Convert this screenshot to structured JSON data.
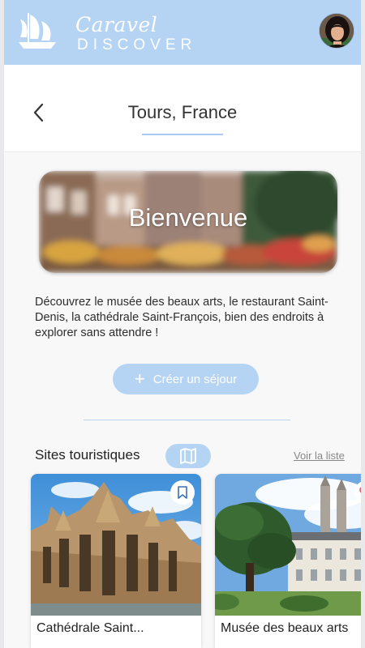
{
  "app": {
    "logo_script": "Caravel",
    "logo_word": "DISCOVER"
  },
  "header": {
    "title": "Tours, France"
  },
  "hero": {
    "title": "Bienvenue"
  },
  "intro": {
    "text": "Découvrez le musée des beaux arts, le restaurant Saint-Denis, la cathédrale Saint-François, bien des endroits à explorer sans attendre !"
  },
  "actions": {
    "create_stay_label": "Créer un séjour",
    "create_stay_icon": "plus-icon"
  },
  "sites": {
    "section_title": "Sites touristiques",
    "view_list_label": "Voir la liste",
    "map_icon": "map-icon",
    "cards": [
      {
        "label": "Cathédrale Saint...",
        "action_icon": "bookmark-icon"
      },
      {
        "label": "Musée des beaux arts",
        "action_icon": "heart-icon"
      }
    ]
  },
  "colors": {
    "accent": "#b5d4f4",
    "accent_line": "#a9c9ee",
    "background": "#f8f8f9",
    "heart": "#e05a6b"
  }
}
